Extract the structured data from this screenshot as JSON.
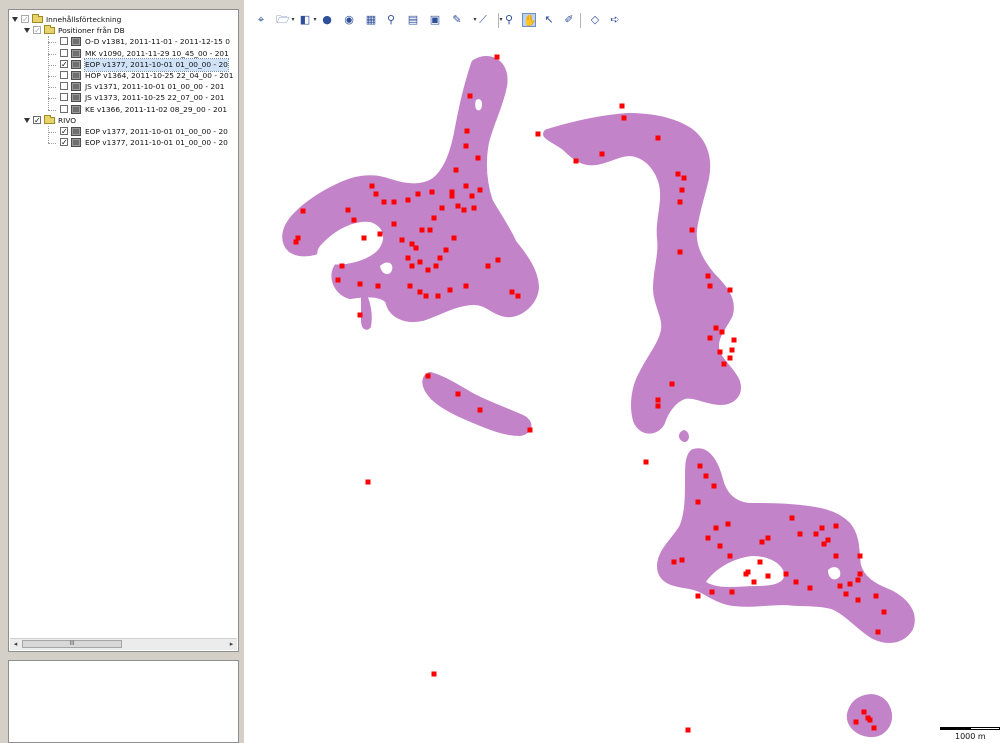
{
  "tree": {
    "root": {
      "label": "Innehållsförteckning"
    },
    "groups": [
      {
        "label": "Positioner från DB",
        "checked": false,
        "items": [
          {
            "label": "O-D v1381, 2011-11-01 - 2011-12-15 0",
            "checked": false,
            "selected": false
          },
          {
            "label": "MK v1090, 2011-11-29 10_45_00 - 201",
            "checked": false,
            "selected": false
          },
          {
            "label": "EOP v1377, 2011-10-01 01_00_00 - 20",
            "checked": true,
            "selected": true
          },
          {
            "label": "HOP v1364, 2011-10-25 22_04_00 - 201",
            "checked": false,
            "selected": false
          },
          {
            "label": "JS v1371, 2011-10-01 01_00_00 - 201",
            "checked": false,
            "selected": false
          },
          {
            "label": "JS v1373, 2011-10-25 22_07_00 - 201",
            "checked": false,
            "selected": false
          },
          {
            "label": "KE v1366, 2011-11-02 08_29_00 - 201",
            "checked": false,
            "selected": false
          }
        ]
      },
      {
        "label": "RIVO",
        "checked": true,
        "items": [
          {
            "label": "EOP v1377, 2011-10-01 01_00_00 - 20",
            "checked": true,
            "selected": false
          },
          {
            "label": "EOP v1377, 2011-10-01 01_00_00 - 20",
            "checked": true,
            "selected": false
          }
        ]
      }
    ]
  },
  "toolbar": {
    "tools": [
      {
        "icon": "full-extent-icon",
        "glyph": "⌖",
        "active": false
      },
      {
        "icon": "open-folder-icon",
        "glyph": "🗁",
        "active": false
      },
      {
        "icon": "add-data-icon",
        "glyph": "◧",
        "active": false
      },
      {
        "icon": "globe-icon",
        "glyph": "●",
        "active": false
      },
      {
        "icon": "circle-layer-icon",
        "glyph": "◉",
        "active": false
      },
      {
        "icon": "table-icon",
        "glyph": "▦",
        "active": false
      },
      {
        "icon": "identify-icon",
        "glyph": "⚲",
        "active": false
      },
      {
        "icon": "attribute-table-icon",
        "glyph": "▤",
        "active": false
      },
      {
        "icon": "print-icon",
        "glyph": "▣",
        "active": false
      },
      {
        "icon": "draw-icon",
        "glyph": "✎",
        "active": false
      },
      {
        "icon": "measure-icon",
        "glyph": "⟋",
        "active": false
      },
      {
        "icon": "zoom-icon",
        "glyph": "⚲",
        "active": false
      },
      {
        "icon": "pan-icon",
        "glyph": "✋",
        "active": true
      },
      {
        "icon": "select-arrow-icon",
        "glyph": "↖",
        "active": false
      },
      {
        "icon": "edit-icon",
        "glyph": "✐",
        "active": false
      },
      {
        "icon": "back-icon",
        "glyph": "◇",
        "active": false
      },
      {
        "icon": "forward-icon",
        "glyph": "➪",
        "active": false
      }
    ]
  },
  "scrollbar": {
    "thumb_label": "III"
  },
  "map": {
    "fill_color": "#c383c9",
    "point_color": "#ff0000",
    "scale_label": "1000 m"
  }
}
